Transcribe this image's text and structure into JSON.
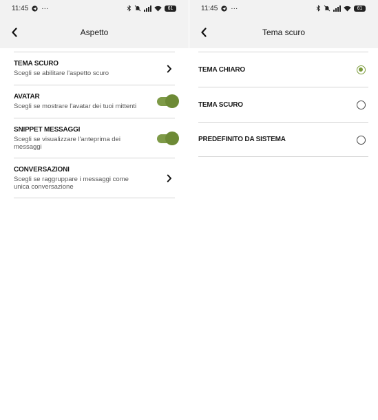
{
  "status_bar": {
    "time": "11:45",
    "overflow": "···",
    "battery": "61"
  },
  "icons": {
    "back": "arrow-left-icon",
    "telegram": "telegram-icon",
    "bluetooth": "bluetooth-icon",
    "mute": "bell-off-icon",
    "signal": "signal-icon",
    "wifi": "wifi-icon",
    "battery": "battery-icon",
    "chevron": "chevron-right-icon"
  },
  "colors": {
    "accent": "#7a9a3a",
    "toggle_track": "#7e9a47",
    "toggle_thumb": "#6d8a36",
    "appbar_bg": "#f2f2f2"
  },
  "appearance_screen": {
    "title": "Aspetto",
    "items": [
      {
        "title": "TEMA SCURO",
        "description": "Scegli se abilitare l'aspetto scuro",
        "control": "chevron"
      },
      {
        "title": "AVATAR",
        "description": "Scegli se mostrare l'avatar dei tuoi mittenti",
        "control": "toggle",
        "enabled": true
      },
      {
        "title": "SNIPPET MESSAGGI",
        "description": "Scegli se visualizzare l'anteprima dei messaggi",
        "control": "toggle",
        "enabled": true
      },
      {
        "title": "CONVERSAZIONI",
        "description": "Scegli se raggruppare i messaggi come unica conversazione",
        "control": "chevron"
      }
    ]
  },
  "theme_screen": {
    "title": "Tema scuro",
    "options": [
      {
        "label": "TEMA CHIARO",
        "selected": true
      },
      {
        "label": "TEMA SCURO",
        "selected": false
      },
      {
        "label": "PREDEFINITO DA SISTEMA",
        "selected": false
      }
    ]
  }
}
